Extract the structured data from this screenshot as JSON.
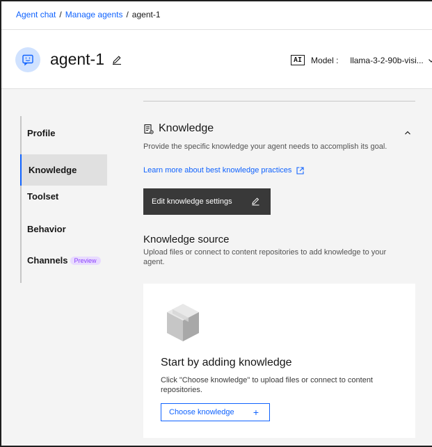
{
  "breadcrumb": {
    "items": [
      "Agent chat",
      "Manage agents",
      "agent-1"
    ],
    "separator": "/"
  },
  "agent": {
    "name": "agent-1",
    "avatar_icon": "chat-bot-icon",
    "edit_icon": "pencil-icon"
  },
  "model": {
    "badge": "AI",
    "label": "Model :",
    "value": "llama-3-2-90b-visi...",
    "dropdown_icon": "chevron-down-icon"
  },
  "sidebar": {
    "items": [
      {
        "label": "Profile",
        "active": false
      },
      {
        "label": "Knowledge",
        "active": true
      },
      {
        "label": "Toolset",
        "active": false
      },
      {
        "label": "Behavior",
        "active": false
      },
      {
        "label": "Channels",
        "active": false,
        "tag": "Preview"
      }
    ]
  },
  "knowledge": {
    "title": "Knowledge",
    "description": "Provide the specific knowledge your agent needs to accomplish its goal.",
    "link": "Learn more about best knowledge practices",
    "edit_button": "Edit knowledge settings"
  },
  "knowledge_source": {
    "title": "Knowledge source",
    "description": "Upload files or connect to content repositories to add knowledge to your agent."
  },
  "empty_state": {
    "title": "Start by adding knowledge",
    "description": "Click \"Choose knowledge\" to upload files or connect to content repositories.",
    "button": "Choose knowledge",
    "button_icon": "+"
  },
  "colors": {
    "accent": "#0f62fe",
    "avatar_bg": "#d0e2ff",
    "dark_button": "#393939",
    "preview_tag": "#8a3ffc"
  }
}
